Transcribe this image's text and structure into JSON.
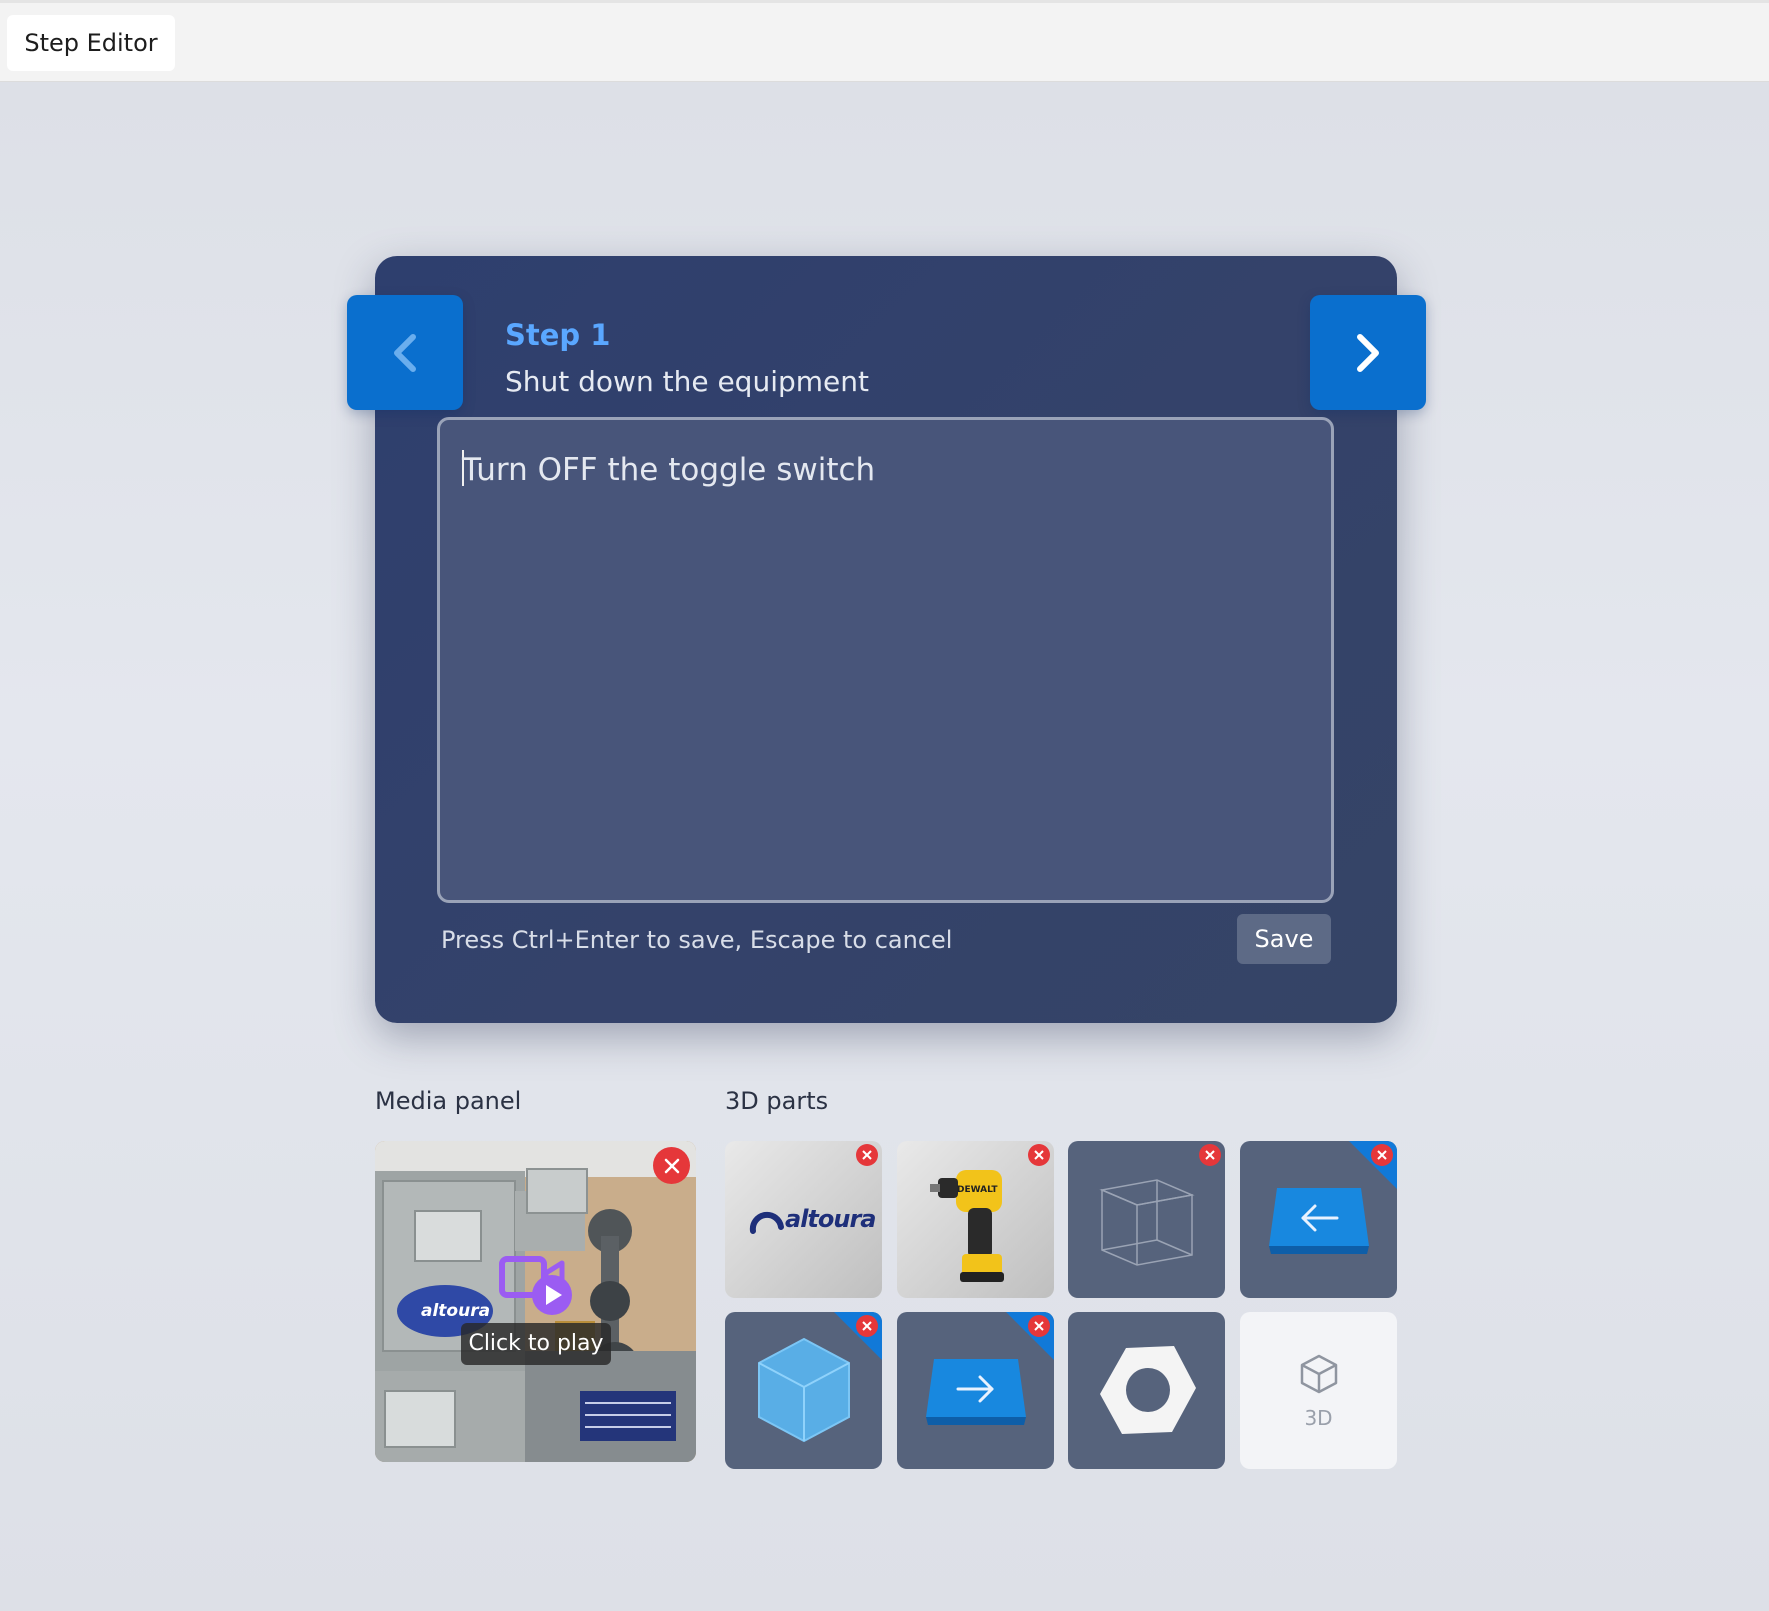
{
  "window": {
    "tab_title": "Step Editor"
  },
  "step": {
    "label": "Step 1",
    "title": "Shut down the equipment",
    "instruction_text": "Turn OFF the toggle switch",
    "hint": "Press Ctrl+Enter to save, Escape to cancel",
    "save_label": "Save"
  },
  "media_panel": {
    "label": "Media panel",
    "video_tooltip": "Click to play",
    "logo_text": "altoura"
  },
  "parts_panel": {
    "label": "3D parts",
    "items": [
      {
        "name": "altoura-logo-part",
        "logo_text": "altoura",
        "removable": true
      },
      {
        "name": "impact-driver-part",
        "brand_text": "DEWALT",
        "removable": true
      },
      {
        "name": "wireframe-cube-part",
        "removable": true
      },
      {
        "name": "left-arrow-button-part",
        "removable": true
      },
      {
        "name": "blue-cube-part",
        "removable": true
      },
      {
        "name": "right-arrow-button-part",
        "removable": true
      },
      {
        "name": "hex-nut-part",
        "removable": false
      }
    ],
    "add_label": "3D"
  },
  "colors": {
    "accent": "#0a6fce",
    "step_label": "#5aa7ff",
    "card": "#2e3f6e",
    "remove": "#e5373a",
    "video_icon": "#9b5cf2"
  },
  "icons": {
    "prev": "chevron-left-icon",
    "next": "chevron-right-icon",
    "remove": "close-icon",
    "video": "video-camera-icon",
    "play": "play-icon",
    "add": "cube-outline-icon"
  }
}
